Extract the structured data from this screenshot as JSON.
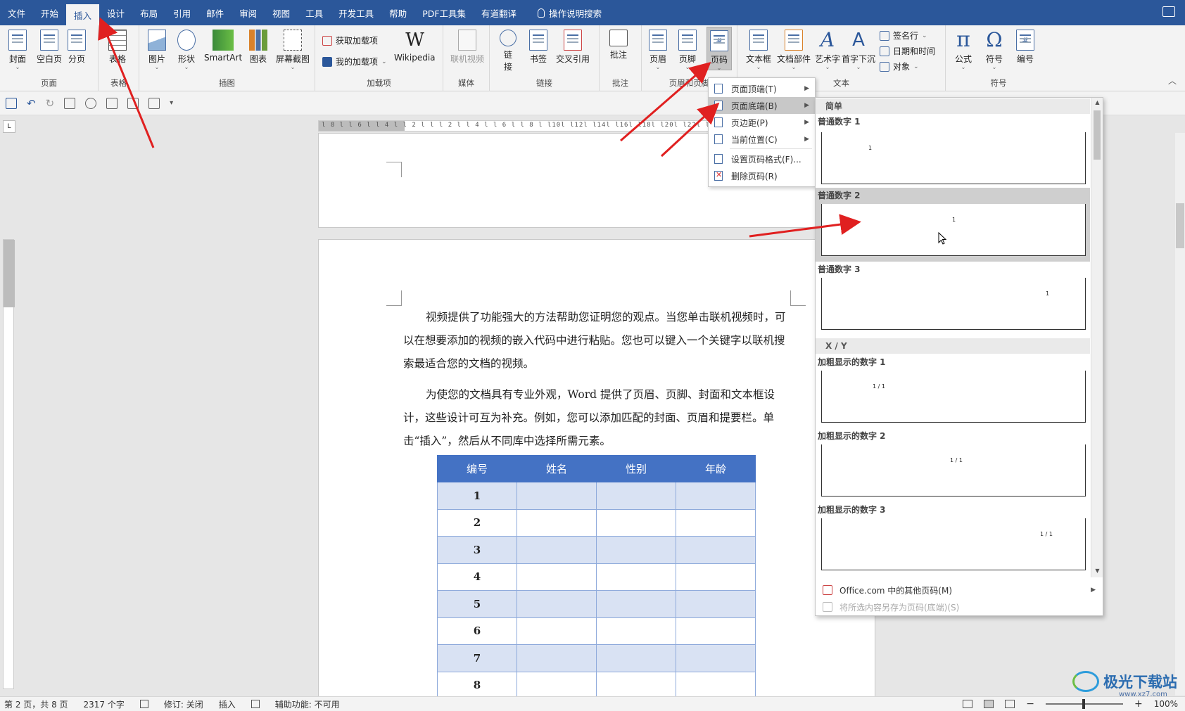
{
  "tabs": [
    "文件",
    "开始",
    "插入",
    "设计",
    "布局",
    "引用",
    "邮件",
    "审阅",
    "视图",
    "工具",
    "开发工具",
    "帮助",
    "PDF工具集",
    "有道翻译"
  ],
  "active_tab": "插入",
  "tell_me": "操作说明搜索",
  "ribbon": {
    "groups": {
      "pages": "页面",
      "tables": "表格",
      "illustrations": "插图",
      "addins": "加载项",
      "media": "媒体",
      "links": "链接",
      "comments": "批注",
      "header_footer": "页眉和页脚",
      "text": "文本",
      "symbols": "符号"
    },
    "buttons": {
      "cover": "封面",
      "blank": "空白页",
      "break": "分页",
      "table": "表格",
      "picture": "图片",
      "shapes": "形状",
      "smartart": "SmartArt",
      "chart": "图表",
      "screenshot": "屏幕截图",
      "get_addins": "获取加载项",
      "my_addins": "我的加载项",
      "wikipedia": "Wikipedia",
      "online_video": "联机视频",
      "link_1": "链",
      "link_2": "接",
      "bookmark": "书签",
      "crossref": "交叉引用",
      "comment": "批注",
      "header": "页眉",
      "footer": "页脚",
      "page_number": "页码",
      "textbox": "文本框",
      "quick_parts": "文档部件",
      "wordart": "艺术字",
      "dropcap": "首字下沉",
      "signature": "签名行",
      "datetime": "日期和时间",
      "object": "对象",
      "equation": "公式",
      "symbol": "符号",
      "numbering": "编号"
    }
  },
  "ruler_numbers": "l 8 l  l 6 l  l 4 l  l 2 l     l     l 2 l  l 4 l  l 6 l  l 8 l  l10l  l12l  l14l  l16l  l18l  l20l  l22l  l24l  l26l",
  "document": {
    "paragraphs": [
      "视频提供了功能强大的方法帮助您证明您的观点。当您单击联机视频时，可以在想要添加的视频的嵌入代码中进行粘贴。您也可以键入一个关键字以联机搜索最适合您的文档的视频。",
      "为使您的文档具有专业外观，Word 提供了页眉、页脚、封面和文本框设计，这些设计可互为补充。例如，您可以添加匹配的封面、页眉和提要栏。单击“插入”，然后从不同库中选择所需元素。"
    ],
    "table": {
      "headers": [
        "编号",
        "姓名",
        "性别",
        "年龄"
      ],
      "rows": [
        [
          "1",
          "",
          "",
          ""
        ],
        [
          "2",
          "",
          "",
          ""
        ],
        [
          "3",
          "",
          "",
          ""
        ],
        [
          "4",
          "",
          "",
          ""
        ],
        [
          "5",
          "",
          "",
          ""
        ],
        [
          "6",
          "",
          "",
          ""
        ],
        [
          "7",
          "",
          "",
          ""
        ],
        [
          "8",
          "",
          "",
          ""
        ]
      ]
    }
  },
  "page_number_menu": {
    "items": [
      {
        "label": "页面顶端(T)",
        "submenu": true
      },
      {
        "label": "页面底端(B)",
        "submenu": true,
        "highlighted": true
      },
      {
        "label": "页边距(P)",
        "submenu": true
      },
      {
        "label": "当前位置(C)",
        "submenu": true
      },
      {
        "label": "设置页码格式(F)...",
        "submenu": false
      },
      {
        "label": "删除页码(R)",
        "submenu": false
      }
    ]
  },
  "gallery": {
    "section_simple": "简单",
    "section_xy": "X / Y",
    "items": [
      {
        "title": "普通数字 1",
        "preview": "1"
      },
      {
        "title": "普通数字 2",
        "preview": "1",
        "highlighted": true
      },
      {
        "title": "普通数字 3",
        "preview": "1"
      },
      {
        "title": "加粗显示的数字 1",
        "preview": "1 / 1"
      },
      {
        "title": "加粗显示的数字 2",
        "preview": "1 / 1"
      },
      {
        "title": "加粗显示的数字 3",
        "preview": "1 / 1"
      }
    ],
    "more_online": "Office.com 中的其他页码(M)",
    "save_selection": "将所选内容另存为页码(底端)(S)"
  },
  "status": {
    "page": "第 2 页，共 8 页",
    "words": "2317 个字",
    "track_changes": "修订: 关闭",
    "insert_mode": "插入",
    "accessibility": "辅助功能: 不可用",
    "zoom": "100%"
  },
  "watermark": {
    "text": "极光下载站",
    "url": "www.xz7.com"
  },
  "colors": {
    "brand": "#2b579a",
    "table_header": "#4472c4",
    "table_band": "#d9e2f3",
    "annotation_arrow": "#e02020"
  }
}
